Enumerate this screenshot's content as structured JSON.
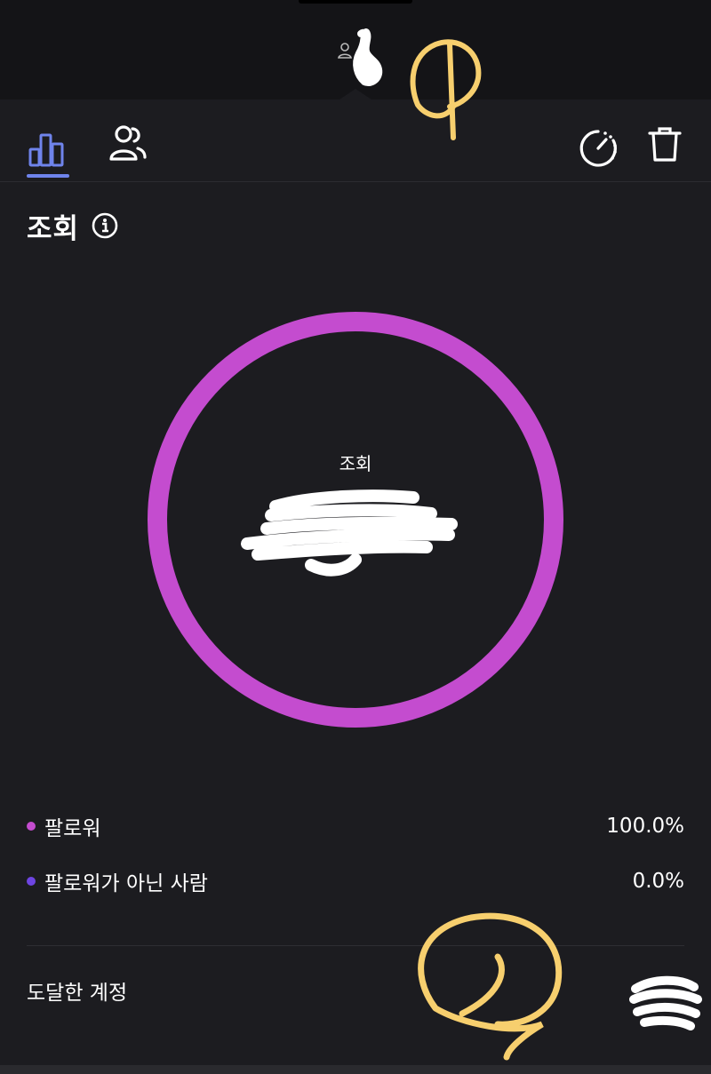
{
  "toolbar": {
    "tabs": [
      {
        "name": "insights",
        "icon": "bar-chart-icon",
        "active": true
      },
      {
        "name": "audience",
        "icon": "people-icon",
        "active": false
      }
    ],
    "actions": [
      {
        "icon": "timer-icon"
      },
      {
        "icon": "trash-icon"
      }
    ],
    "active_color": "#6f84ec"
  },
  "section": {
    "title": "조회"
  },
  "chart_data": {
    "type": "pie",
    "title": "조회",
    "slices": [
      {
        "label": "팔로워",
        "value": 100.0,
        "color": "#c44ccf"
      },
      {
        "label": "팔로워가 아닌 사람",
        "value": 0.0,
        "color": "#6e45e2"
      }
    ]
  },
  "legend": [
    {
      "label": "팔로워",
      "value": "100.0%",
      "color": "#c44ccf"
    },
    {
      "label": "팔로워가 아닌 사람",
      "value": "0.0%",
      "color": "#6e45e2"
    }
  ],
  "reached": {
    "label": "도달한 계정"
  }
}
